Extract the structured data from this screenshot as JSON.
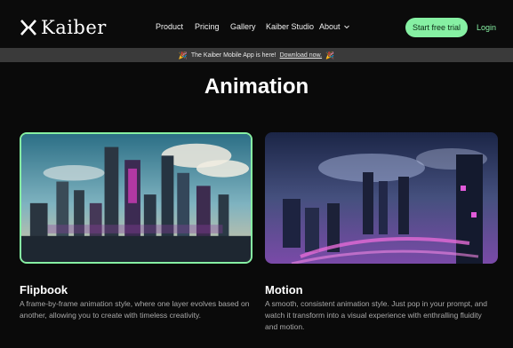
{
  "brand": {
    "name": "Kaiber",
    "logo_icon": "kaiber-logo-icon"
  },
  "nav": {
    "items": [
      {
        "label": "Product"
      },
      {
        "label": "Pricing"
      },
      {
        "label": "Gallery"
      },
      {
        "label": "Kaiber Studio"
      },
      {
        "label": "About"
      }
    ],
    "cta_label": "Start free trial",
    "login_label": "Login"
  },
  "banner": {
    "text": "The Kaiber Mobile App is here!",
    "link": "Download now."
  },
  "page": {
    "title": "Animation"
  },
  "cards": [
    {
      "title": "Flipbook",
      "description": "A frame-by-frame animation style, where one layer evolves based on another, allowing you to create with timeless creativity."
    },
    {
      "title": "Motion",
      "description": "A smooth, consistent animation style. Just pop in your prompt, and watch it transform into a visual experience with enthralling fluidity and motion."
    }
  ],
  "colors": {
    "accent": "#86f0a3",
    "background": "#0a0a0a",
    "banner": "#3a3a3a"
  }
}
